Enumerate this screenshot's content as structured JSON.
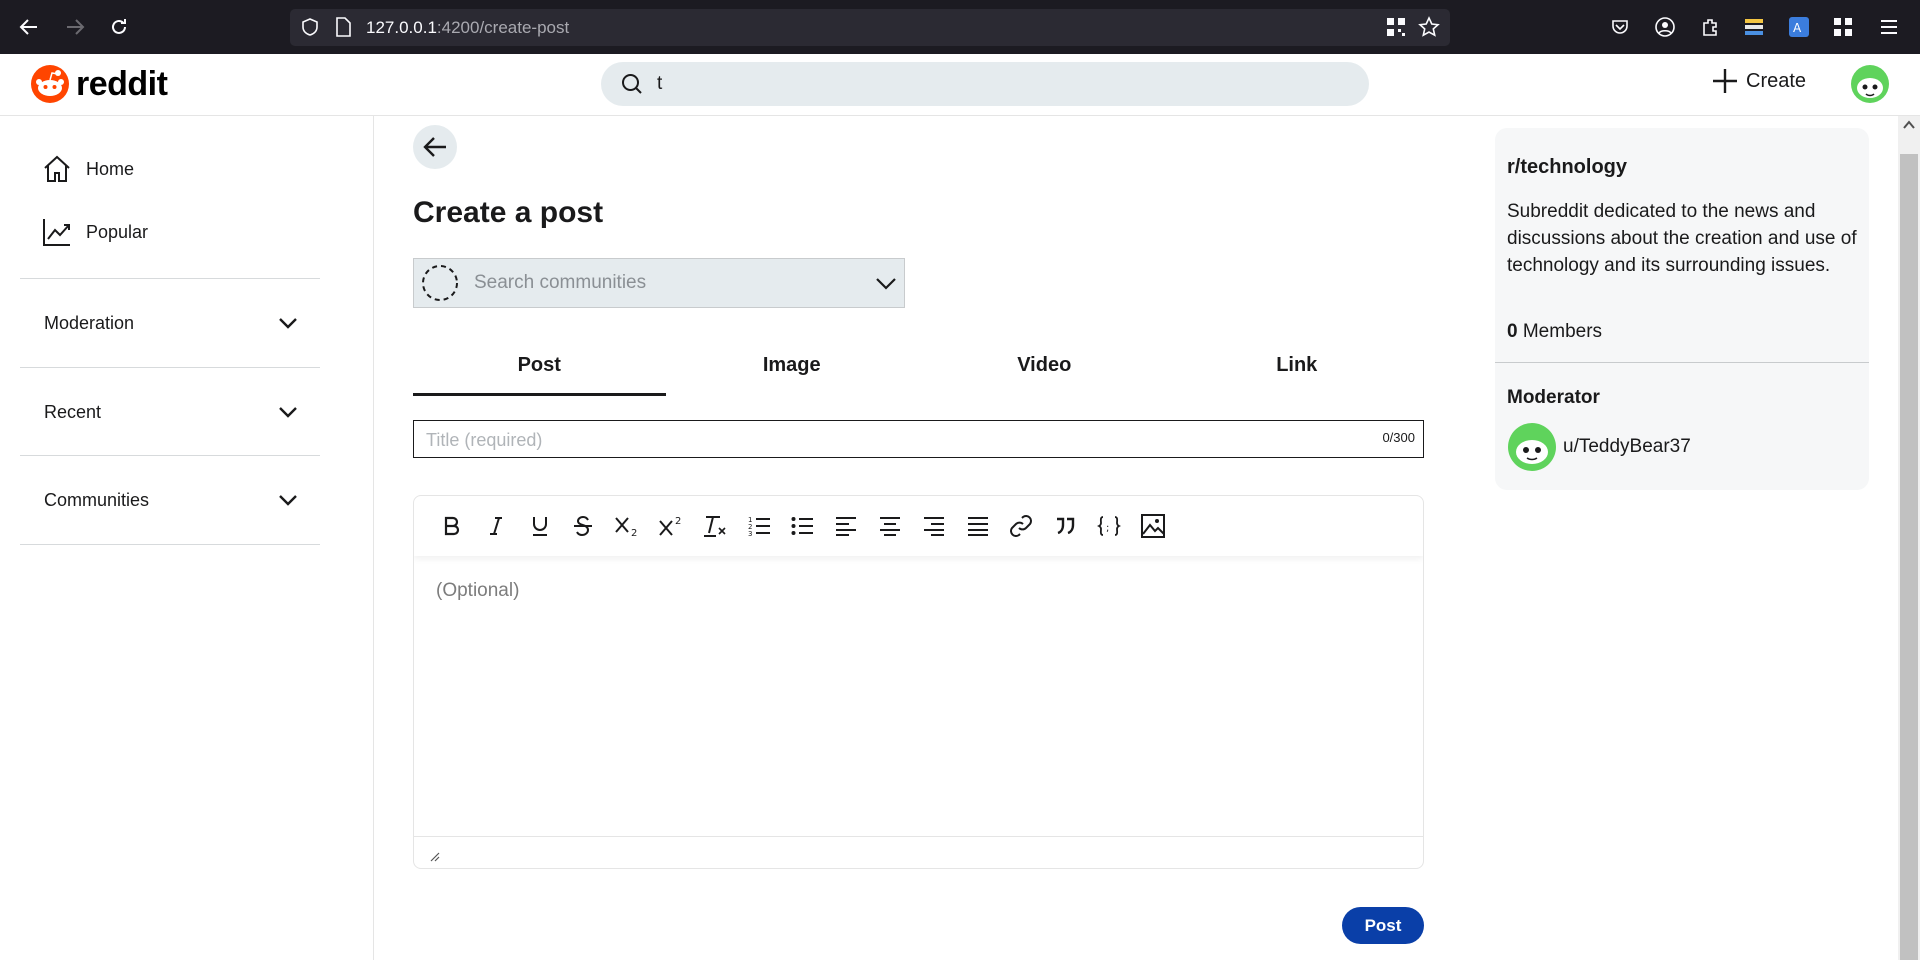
{
  "browser": {
    "url_host": "127.0.0.1",
    "url_rest": ":4200/create-post"
  },
  "header": {
    "logo_text": "reddit",
    "search_value": "t",
    "create_label": "Create"
  },
  "sidebar": {
    "items": [
      {
        "label": "Home",
        "icon": "home-icon"
      },
      {
        "label": "Popular",
        "icon": "trending-icon"
      }
    ],
    "sections": [
      {
        "label": "Moderation"
      },
      {
        "label": "Recent"
      },
      {
        "label": "Communities"
      }
    ]
  },
  "main": {
    "title": "Create a post",
    "community_placeholder": "Search communities",
    "tabs": [
      {
        "label": "Post",
        "active": true
      },
      {
        "label": "Image",
        "active": false
      },
      {
        "label": "Video",
        "active": false
      },
      {
        "label": "Link",
        "active": false
      }
    ],
    "title_placeholder": "Title (required)",
    "title_count": "0/300",
    "body_placeholder": "(Optional)",
    "toolbar": [
      "bold-icon",
      "italic-icon",
      "underline-icon",
      "strikethrough-icon",
      "subscript-icon",
      "superscript-icon",
      "clear-format-icon",
      "ordered-list-icon",
      "bullet-list-icon",
      "align-left-icon",
      "align-center-icon",
      "align-right-icon",
      "align-justify-icon",
      "link-icon",
      "quote-icon",
      "code-block-icon",
      "image-icon"
    ],
    "post_label": "Post"
  },
  "community_panel": {
    "name": "r/technology",
    "description": "Subreddit dedicated to the news and discussions about the creation and use of technology and its surrounding issues.",
    "member_count": "0",
    "member_label": "Members",
    "moderator_heading": "Moderator",
    "moderator": "u/TeddyBear37"
  },
  "colors": {
    "accent": "#0a3fa8",
    "logo": "#ff4500",
    "avatar": "#5fd35c"
  }
}
